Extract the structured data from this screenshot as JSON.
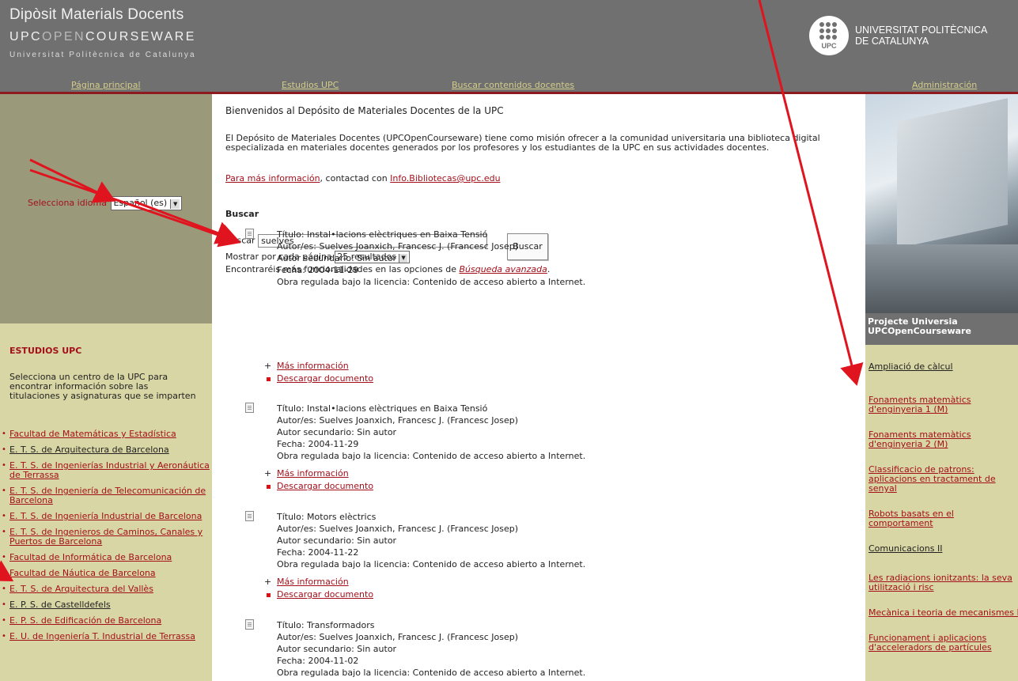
{
  "header": {
    "title1": "Dipòsit Materials Docents",
    "title2_a": "UPC",
    "title2_b": "OPEN",
    "title2_c": "COURSEWARE",
    "title3": "Universitat Politècnica de Catalunya",
    "logo_label": "UPC",
    "univ_line1": "UNIVERSITAT POLITÈCNICA",
    "univ_line2": "DE CATALUNYA"
  },
  "nav": {
    "home": "Página principal",
    "studies": "Estudios UPC",
    "search": "Buscar contenidos docentes",
    "admin": "Administración"
  },
  "language": {
    "label": "Selecciona idioma",
    "selected": "Español (es)"
  },
  "studies": {
    "title": "ESTUDIOS UPC",
    "intro": "Selecciona un centro de la UPC para encontrar información sobre las titulaciones y asignaturas que se imparten",
    "items": [
      "Facultad de Matemáticas y Estadística",
      "E. T. S. de Arquitectura de Barcelona",
      "E. T. S. de Ingenierías Industrial y Aeronáutica de Terrassa",
      "E. T. S. de Ingeniería de Telecomunicación de Barcelona",
      "E. T. S. de Ingeniería Industrial de Barcelona",
      "E. T. S. de Ingenieros de Caminos, Canales y Puertos de Barcelona",
      "Facultad de Informática de Barcelona",
      "Facultad de Náutica de Barcelona",
      "E. T. S. de Arquitectura del Vallès",
      "E. P. S. de Castelldefels",
      "E. P. S. de Edificación de Barcelona",
      "E. U. de Ingeniería T. Industrial de Terrassa"
    ]
  },
  "main": {
    "welcome": "Bienvenidos al Depósito de Materiales Docentes de la UPC",
    "mission": "El Depósito de Materiales Docentes (UPCOpenCourseware) tiene como misión ofrecer a la comunidad universitaria una biblioteca digital especializada en materiales docentes generados por los profesores y los estudiantes de la UPC en sus actividades docentes.",
    "more_info_link": "Para más información",
    "more_info_mid": ", contactad con ",
    "email": "Info.Bibliotecas@upc.edu",
    "search_heading": "Buscar",
    "search_label": "Buscar",
    "search_value": "suelves",
    "per_page_label": "Mostrar por cada página",
    "per_page_value": "25 resultados",
    "adv_prefix": "Encontraréis más funcionalidades en las opciones de ",
    "adv_link": "Búsqueda avanzada",
    "adv_suffix": ".",
    "search_button": "Buscar",
    "more_label": "Más información",
    "download_label": "Descargar documento"
  },
  "results": [
    {
      "title": "Título: Instal•lacions elèctriques en Baixa Tensió",
      "author": "Autor/es: Suelves Joanxich, Francesc J. (Francesc Josep)",
      "secondary": "Autor secundario: Sin autor",
      "date": "Fecha: 2004-11-29",
      "license": "Obra regulada bajo la licencia: Contenido de acceso abierto a Internet."
    },
    {
      "title": "Título: Instal•lacions elèctriques en Baixa Tensió",
      "author": "Autor/es: Suelves Joanxich, Francesc J. (Francesc Josep)",
      "secondary": "Autor secundario: Sin autor",
      "date": "Fecha: 2004-11-29",
      "license": "Obra regulada bajo la licencia: Contenido de acceso abierto a Internet."
    },
    {
      "title": "Título: Motors elèctrics",
      "author": "Autor/es: Suelves Joanxich, Francesc J. (Francesc Josep)",
      "secondary": "Autor secundario: Sin autor",
      "date": "Fecha: 2004-11-22",
      "license": "Obra regulada bajo la licencia: Contenido de acceso abierto a Internet."
    },
    {
      "title": "Título: Transformadors",
      "author": "Autor/es: Suelves Joanxich, Francesc J. (Francesc Josep)",
      "secondary": "Autor secundario: Sin autor",
      "date": "Fecha: 2004-11-02",
      "license": "Obra regulada bajo la licencia: Contenido de acceso abierto a Internet."
    }
  ],
  "right": {
    "project_line1": "Projecte Universia",
    "project_line2": "UPCOpenCourseware",
    "items": [
      "Ampliació de càlcul",
      "Fonaments matemàtics d'enginyeria 1 (M)",
      "Fonaments matemàtics d'enginyeria 2 (M)",
      "Classificacio de patrons: aplicacions en tractament de senyal",
      "Robots basats en el comportament",
      "Comunicacions II",
      "Les radiacions ionitzants: la seva utilització i risc",
      "Mecànica i teoria de mecanismes II",
      "Funcionament i aplicacions d'acceleradors de partícules"
    ]
  },
  "colors": {
    "header_bg": "#707070",
    "nav_link": "#d4cc8a",
    "link": "#a3101b",
    "left_top_bg": "#9a9a7b",
    "side_bg": "#d8d6a4",
    "accent_line": "#8c1a1f",
    "annotation_arrow": "#e0141e"
  }
}
